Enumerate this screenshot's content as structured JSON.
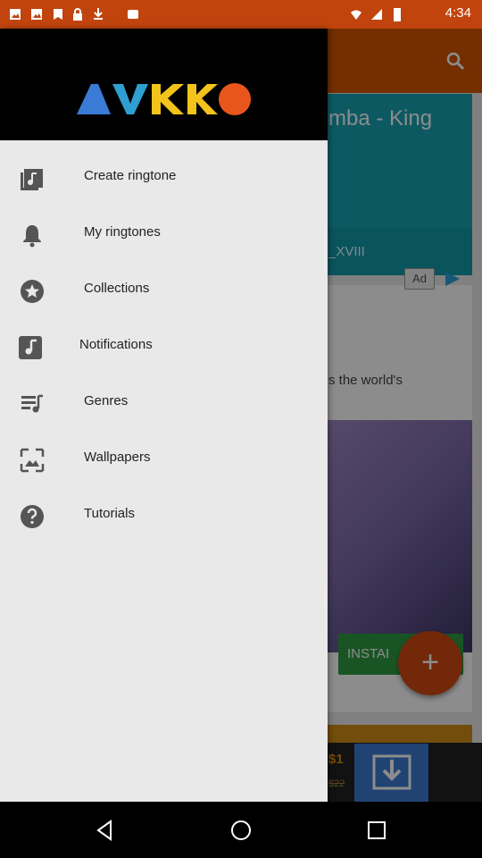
{
  "status_bar": {
    "time": "4:34"
  },
  "background_app": {
    "card_title": "mba - King",
    "card_subtitle": "_XVIII",
    "ad_badge": "Ad",
    "ad_text": "s the world's",
    "install_label": "INSTAI",
    "price": "$1",
    "old_price": "$22"
  },
  "drawer": {
    "items": [
      {
        "label": "Create ringtone",
        "icon": "music-library-icon"
      },
      {
        "label": "My ringtones",
        "icon": "bell-icon"
      },
      {
        "label": "Collections",
        "icon": "star-icon"
      },
      {
        "label": "Notifications",
        "icon": "music-note-icon"
      },
      {
        "label": "Genres",
        "icon": "playlist-icon"
      },
      {
        "label": "Wallpapers",
        "icon": "image-icon"
      },
      {
        "label": "Tutorials",
        "icon": "help-icon"
      }
    ]
  },
  "colors": {
    "accent": "#d35400",
    "drawer_bg": "#e9e9e9",
    "header_bg": "#000000",
    "teal_card": "#18a3b3",
    "install_green": "#2e9b43"
  }
}
